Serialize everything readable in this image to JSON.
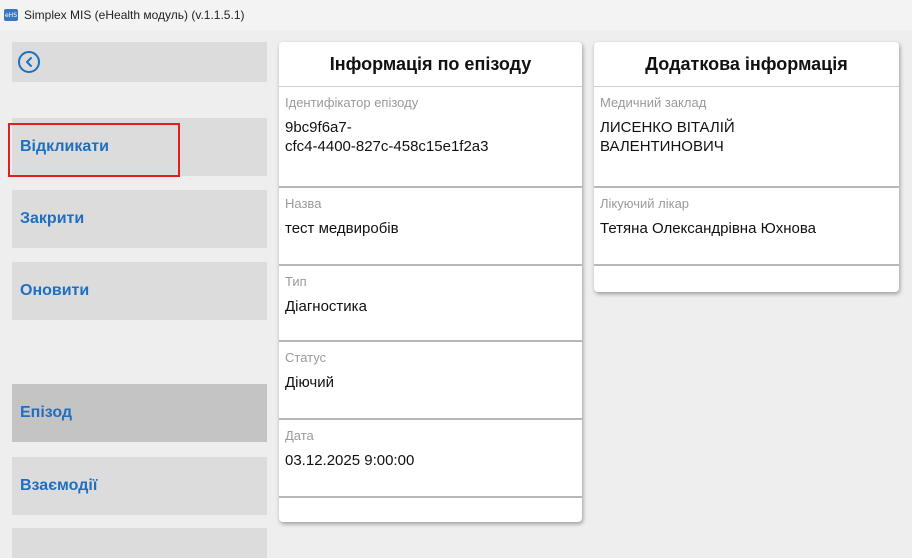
{
  "window": {
    "title": "Simplex MIS (eHealth модуль) (v.1.1.5.1)",
    "icon_text": "eHS"
  },
  "sidebar": {
    "back_icon": "chevron-left-circle-icon",
    "recall_label": "Відкликати",
    "close_label": "Закрити",
    "refresh_label": "Оновити",
    "episode_label": "Епізод",
    "interactions_label": "Взаємодії"
  },
  "episode_card": {
    "title": "Інформація по епізоду",
    "fields": [
      {
        "label": "Ідентифікатор епізоду",
        "value_line1": "9bc9f6a7-",
        "value_line2": "cfc4-4400-827c-458c15e1f2a3"
      },
      {
        "label": "Назва",
        "value": "тест медвиробів"
      },
      {
        "label": "Тип",
        "value": "Діагностика"
      },
      {
        "label": "Статус",
        "value": "Діючий"
      },
      {
        "label": "Дата",
        "value": "03.12.2025 9:00:00"
      }
    ]
  },
  "extra_card": {
    "title": "Додаткова інформація",
    "fields": [
      {
        "label": "Медичний заклад",
        "value_line1": "ЛИСЕНКО ВІТАЛІЙ",
        "value_line2": "ВАЛЕНТИНОВИЧ"
      },
      {
        "label": "Лікуючий лікар",
        "value": "Тетяна Олександрівна Юхнова"
      }
    ]
  },
  "colors": {
    "accent": "#1f6fc0",
    "highlight": "#e02020",
    "sidebar_button": "#dcdcdc",
    "sidebar_button_active": "#c4c4c4"
  }
}
